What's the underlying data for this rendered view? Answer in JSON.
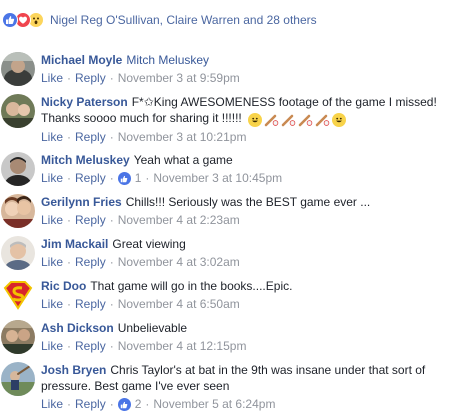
{
  "reactions": {
    "types": [
      "like-icon",
      "love-icon",
      "wow-icon"
    ],
    "names": "Nigel Reg O'Sullivan, Claire Warren and 28 others"
  },
  "actions": {
    "like": "Like",
    "reply": "Reply"
  },
  "comments": [
    {
      "author": "Michael Moyle",
      "text": "",
      "tag": "Mitch Meluskey",
      "likes": "",
      "time": "November 3 at 9:59pm"
    },
    {
      "author": "Nicky Paterson",
      "text": "F*✩King AWESOMENESS footage of the game I missed! Thanks soooo much for sharing it !!!!!!",
      "tag": "",
      "likes": "",
      "time": "November 3 at 10:21pm"
    },
    {
      "author": "Mitch Meluskey",
      "text": "Yeah what a game",
      "tag": "",
      "likes": "1",
      "time": "November 3 at 10:45pm"
    },
    {
      "author": "Gerilynn Fries",
      "text": "Chills!!! Seriously was the BEST game ever ...",
      "tag": "",
      "likes": "",
      "time": "November 4 at 2:23am"
    },
    {
      "author": "Jim Mackail",
      "text": "Great viewing",
      "tag": "",
      "likes": "",
      "time": "November 4 at 3:02am"
    },
    {
      "author": "Ric Doo",
      "text": "That game will go in the books....Epic.",
      "tag": "",
      "likes": "",
      "time": "November 4 at 6:50am"
    },
    {
      "author": "Ash Dickson",
      "text": "Unbelievable",
      "tag": "",
      "likes": "",
      "time": "November 4 at 12:15pm"
    },
    {
      "author": "Josh Bryen",
      "text": "Chris Taylor's at bat in the 9th was insane under that sort of pressure. Best game I've ever seen",
      "tag": "",
      "likes": "2",
      "time": "November 5 at 6:24pm"
    }
  ],
  "emoji": [
    "grinning-face-icon",
    "baseball-bat-icon",
    "baseball-bat-icon",
    "baseball-bat-icon",
    "baseball-bat-icon",
    "grinning-face-icon"
  ],
  "colors": {
    "link": "#385898",
    "meta": "#90949c",
    "like_blue": "#4b75e6",
    "love_red": "#f0454e",
    "wow_yellow": "#fcd55c"
  }
}
